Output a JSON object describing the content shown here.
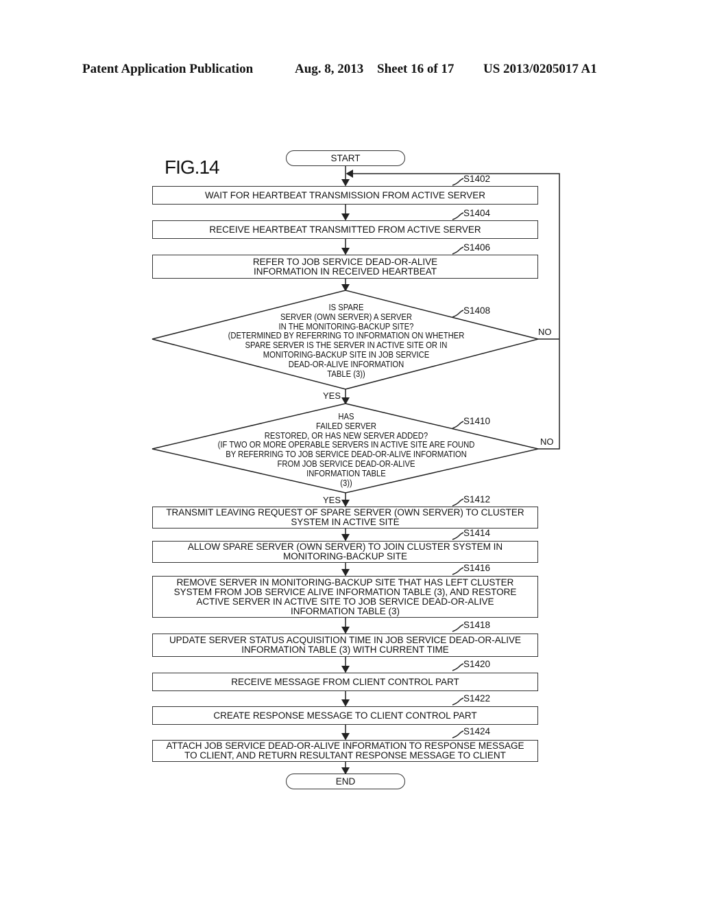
{
  "header": {
    "publication": "Patent Application Publication",
    "date": "Aug. 8, 2013",
    "sheet": "Sheet 16 of 17",
    "number": "US 2013/0205017 A1"
  },
  "figure": {
    "label": "FIG.14",
    "start": "START",
    "end": "END",
    "steps": [
      {
        "id": "S1402",
        "text": "WAIT FOR HEARTBEAT TRANSMISSION FROM ACTIVE SERVER"
      },
      {
        "id": "S1404",
        "text": "RECEIVE HEARTBEAT TRANSMITTED FROM ACTIVE SERVER"
      },
      {
        "id": "S1406",
        "text": "REFER TO JOB SERVICE DEAD-OR-ALIVE\nINFORMATION IN RECEIVED HEARTBEAT"
      },
      {
        "id": "S1408",
        "text": "IS SPARE\nSERVER (OWN SERVER) A SERVER\nIN THE MONITORING-BACKUP SITE?\n(DETERMINED BY REFERRING TO INFORMATION ON WHETHER\nSPARE SERVER IS THE SERVER IN ACTIVE SITE OR IN\nMONITORING-BACKUP SITE IN JOB SERVICE\nDEAD-OR-ALIVE INFORMATION\nTABLE (3))",
        "yes": "YES",
        "no": "NO"
      },
      {
        "id": "S1410",
        "text": "HAS\nFAILED SERVER\nRESTORED, OR HAS NEW SERVER ADDED?\n(IF TWO OR MORE OPERABLE SERVERS IN ACTIVE SITE ARE FOUND\nBY REFERRING TO JOB SERVICE DEAD-OR-ALIVE INFORMATION\nFROM JOB SERVICE DEAD-OR-ALIVE\nINFORMATION TABLE\n(3))",
        "yes": "YES",
        "no": "NO"
      },
      {
        "id": "S1412",
        "text": "TRANSMIT LEAVING REQUEST OF SPARE SERVER (OWN SERVER) TO CLUSTER\nSYSTEM IN ACTIVE SITE"
      },
      {
        "id": "S1414",
        "text": "ALLOW SPARE SERVER (OWN SERVER) TO JOIN CLUSTER SYSTEM IN\nMONITORING-BACKUP SITE"
      },
      {
        "id": "S1416",
        "text": "REMOVE SERVER IN MONITORING-BACKUP SITE THAT HAS LEFT CLUSTER\nSYSTEM FROM JOB SERVICE ALIVE INFORMATION TABLE (3), AND RESTORE\nACTIVE SERVER IN ACTIVE SITE TO JOB SERVICE DEAD-OR-ALIVE\nINFORMATION TABLE (3)"
      },
      {
        "id": "S1418",
        "text": "UPDATE SERVER STATUS ACQUISITION TIME IN JOB SERVICE DEAD-OR-ALIVE\nINFORMATION TABLE (3) WITH CURRENT TIME"
      },
      {
        "id": "S1420",
        "text": "RECEIVE MESSAGE FROM CLIENT CONTROL PART"
      },
      {
        "id": "S1422",
        "text": "CREATE RESPONSE MESSAGE TO CLIENT CONTROL PART"
      },
      {
        "id": "S1424",
        "text": "ATTACH JOB SERVICE DEAD-OR-ALIVE INFORMATION TO RESPONSE MESSAGE\nTO CLIENT, AND RETURN RESULTANT RESPONSE MESSAGE TO CLIENT"
      }
    ]
  }
}
